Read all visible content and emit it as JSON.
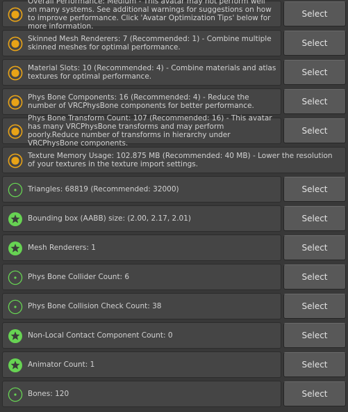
{
  "colors": {
    "warning": "#e8a317",
    "good": "#67d353",
    "panel": "#454545",
    "button": "#585858"
  },
  "items": [
    {
      "icon": "warning-ring-icon",
      "text": "Overall Performance: Medium - This avatar may not perform well on many systems. See additional warnings for suggestions on how to improve performance. Click 'Avatar Optimization Tips' below for more information.",
      "button": "Select"
    },
    {
      "icon": "warning-ring-icon",
      "text": "Skinned Mesh Renderers: 7 (Recommended: 1) - Combine multiple skinned meshes for optimal performance.",
      "button": "Select"
    },
    {
      "icon": "warning-ring-icon",
      "text": "Material Slots: 10 (Recommended: 4) - Combine materials and atlas textures for optimal performance.",
      "button": "Select"
    },
    {
      "icon": "warning-ring-icon",
      "text": "Phys Bone Components: 16 (Recommended: 4) - Reduce the number of VRCPhysBone components for better performance.",
      "button": "Select"
    },
    {
      "icon": "warning-ring-icon",
      "text": "Phys Bone Transform Count: 107 (Recommended: 16) - This avatar has many VRCPhysBone transforms and may perform poorly.Reduce number of transforms in hierarchy under VRCPhysBone components.",
      "button": "Select"
    },
    {
      "icon": "warning-ring-icon",
      "text": "Texture Memory Usage: 102.875 MB (Recommended: 40 MB) - Lower the resolution of your textures in the texture import settings.",
      "button": null
    },
    {
      "icon": "good-ring-icon",
      "text": "Triangles: 68819 (Recommended: 32000)",
      "button": "Select"
    },
    {
      "icon": "excellent-star-icon",
      "text": "Bounding box (AABB) size: (2.00, 2.17, 2.01)",
      "button": "Select"
    },
    {
      "icon": "excellent-star-icon",
      "text": "Mesh Renderers: 1",
      "button": "Select"
    },
    {
      "icon": "good-ring-icon",
      "text": "Phys Bone Collider Count: 6",
      "button": "Select"
    },
    {
      "icon": "good-ring-icon",
      "text": "Phys Bone Collision Check Count: 38",
      "button": "Select"
    },
    {
      "icon": "excellent-star-icon",
      "text": "Non-Local Contact Component Count: 0",
      "button": "Select"
    },
    {
      "icon": "excellent-star-icon",
      "text": "Animator Count: 1",
      "button": "Select"
    },
    {
      "icon": "good-ring-icon",
      "text": "Bones: 120",
      "button": "Select"
    }
  ]
}
